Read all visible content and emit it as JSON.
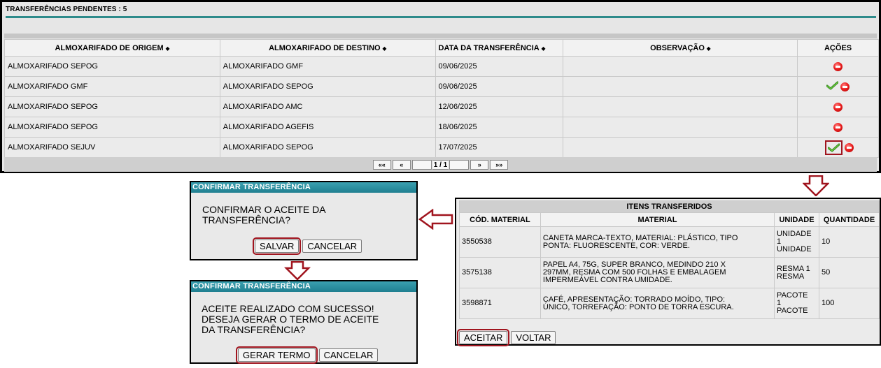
{
  "pending": {
    "title": "TRANSFERÊNCIAS PENDENTES : 5",
    "sort_icon": "sort-icon",
    "columns": {
      "origin": "ALMOXARIFADO DE ORIGEM",
      "destination": "ALMOXARIFADO DE DESTINO",
      "date": "DATA DA TRANSFERÊNCIA",
      "observation": "OBSERVAÇÃO",
      "actions": "AÇÕES"
    },
    "rows": [
      {
        "origin": "ALMOXARIFADO SEPOG",
        "destination": "ALMOXARIFADO GMF",
        "date": "09/06/2025",
        "observation": "",
        "actions": [
          "reject"
        ]
      },
      {
        "origin": "ALMOXARIFADO GMF",
        "destination": "ALMOXARIFADO SEPOG",
        "date": "09/06/2025",
        "observation": "",
        "actions": [
          "accept",
          "reject"
        ]
      },
      {
        "origin": "ALMOXARIFADO SEPOG",
        "destination": "ALMOXARIFADO AMC",
        "date": "12/06/2025",
        "observation": "",
        "actions": [
          "reject"
        ]
      },
      {
        "origin": "ALMOXARIFADO SEPOG",
        "destination": "ALMOXARIFADO AGEFIS",
        "date": "18/06/2025",
        "observation": "",
        "actions": [
          "reject"
        ]
      },
      {
        "origin": "ALMOXARIFADO SEJUV",
        "destination": "ALMOXARIFADO SEPOG",
        "date": "17/07/2025",
        "observation": "",
        "actions": [
          "accept-highlighted",
          "reject"
        ]
      }
    ],
    "pager": {
      "first": "««",
      "prev": "«",
      "page_info": "1 / 1",
      "next": "»",
      "last": "»»"
    }
  },
  "dialog_confirm": {
    "title": "CONFIRMAR TRANSFERÊNCIA",
    "message_line1": "CONFIRMAR O ACEITE DA",
    "message_line2": "TRANSFERÊNCIA?",
    "save_label": "SALVAR",
    "cancel_label": "CANCELAR"
  },
  "dialog_success": {
    "title": "CONFIRMAR TRANSFERÊNCIA",
    "message_line1": "ACEITE REALIZADO COM SUCESSO!",
    "message_line2": "DESEJA GERAR O TERMO DE ACEITE",
    "message_line3": "DA TRANSFERÊNCIA?",
    "generate_label": "GERAR TERMO",
    "cancel_label": "CANCELAR"
  },
  "items": {
    "caption": "ITENS TRANSFERIDOS",
    "columns": {
      "code": "CÓD. MATERIAL",
      "material": "MATERIAL",
      "unit": "UNIDADE",
      "quantity": "QUANTIDADE"
    },
    "rows": [
      {
        "code": "3550538",
        "material_l1": "CANETA MARCA-TEXTO, MATERIAL: PLÁSTICO, TIPO",
        "material_l2": "PONTA: FLUORESCENTE, COR: VERDE.",
        "unit_l1": "UNIDADE",
        "unit_l2": "1",
        "unit_l3": "UNIDADE",
        "quantity": "10"
      },
      {
        "code": "3575138",
        "material_l1": "PAPEL A4, 75G, SUPER BRANCO, MEDINDO 210 X",
        "material_l2": "297MM, RESMA COM 500 FOLHAS E EMBALAGEM",
        "material_l3": "IMPERMEÁVEL CONTRA UMIDADE.",
        "unit_l1": "RESMA 1",
        "unit_l2": "RESMA",
        "quantity": "50"
      },
      {
        "code": "3598871",
        "material_l1": "CAFÉ, APRESENTAÇÃO: TORRADO MOÍDO, TIPO:",
        "material_l2": "ÚNICO, TORREFAÇÃO: PONTO DE TORRA ESCURA.",
        "unit_l1": "PACOTE",
        "unit_l2": "1",
        "unit_l3": "PACOTE",
        "quantity": "100"
      }
    ],
    "accept_label": "ACEITAR",
    "back_label": "VOLTAR"
  },
  "colors": {
    "highlight": "#a0141e",
    "dialog_header": "#1f7f90",
    "accent_rule": "#2e8b8b",
    "panel_bg": "#e6e6e6"
  }
}
